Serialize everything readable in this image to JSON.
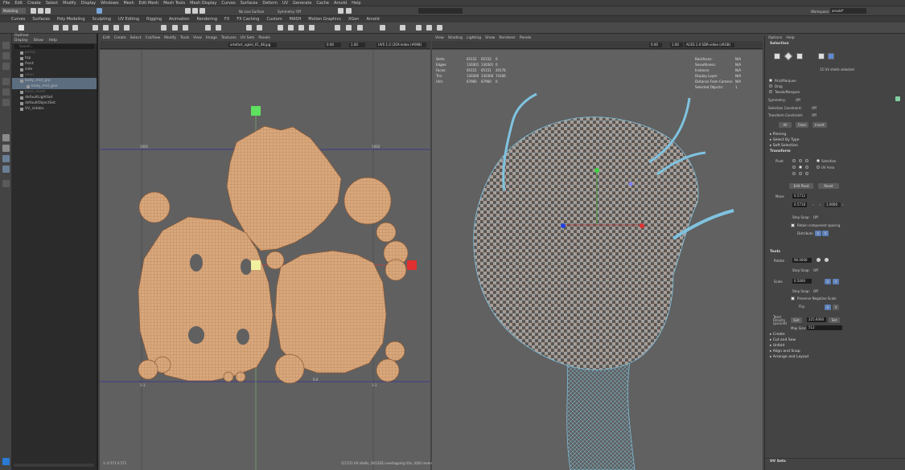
{
  "menubar": {
    "items": [
      "File",
      "Edit",
      "Create",
      "Select",
      "Modify",
      "Display",
      "Windows",
      "Mesh",
      "Edit Mesh",
      "Mesh Tools",
      "Mesh Display",
      "Curves",
      "Surfaces",
      "Deform",
      "UV",
      "Generate",
      "Cache",
      "Arnold",
      "Help"
    ],
    "workspace_label": "Workspace:",
    "workspace_value": "arnold*"
  },
  "status": {
    "mode": "Modeling",
    "live_surface": "No Live Surface",
    "symmetry": "Symmetry: Off"
  },
  "shelf_tabs": [
    "Curves",
    "Surfaces",
    "Poly Modeling",
    "Sculpting",
    "UV Editing",
    "Rigging",
    "Animation",
    "Rendering",
    "FX",
    "FX Caching",
    "Custom",
    "MASH",
    "Motion Graphics",
    "XGen",
    "Arnold"
  ],
  "outliner": {
    "title": "Outliner",
    "menu": [
      "Display",
      "Show",
      "Help"
    ],
    "search_placeholder": "Search...",
    "items": [
      {
        "label": "persp",
        "dim": true,
        "sel": false,
        "indent": 10
      },
      {
        "label": "top",
        "dim": false,
        "sel": false,
        "indent": 10
      },
      {
        "label": "front",
        "dim": false,
        "sel": false,
        "indent": 10
      },
      {
        "label": "side",
        "dim": false,
        "sel": false,
        "indent": 10
      },
      {
        "label": "alien",
        "dim": true,
        "sel": false,
        "indent": 10
      },
      {
        "label": "body_mid_grp",
        "dim": false,
        "sel": true,
        "indent": 10
      },
      {
        "label": "body_mid_geo",
        "dim": false,
        "sel": true,
        "indent": 18
      },
      {
        "label": "base_mesh",
        "dim": true,
        "sel": false,
        "indent": 10
      },
      {
        "label": "defaultLightSet",
        "dim": false,
        "sel": false,
        "indent": 10
      },
      {
        "label": "defaultObjectSet",
        "dim": false,
        "sel": false,
        "indent": 10
      },
      {
        "label": "UV_sidebn",
        "dim": false,
        "sel": false,
        "indent": 10
      }
    ]
  },
  "uv_editor": {
    "menu": [
      "Edit",
      "Create",
      "Select",
      "Cut/Sew",
      "Modify",
      "Tools",
      "View",
      "Image",
      "Textures",
      "UV Sets",
      "Panels"
    ],
    "texture_field": "artefact_ogkid_01_48.jpg",
    "exposure": "0.00",
    "gamma": "1.00",
    "uvset": "UVS 1:2 (20X-index (#008)",
    "tile_labels": [
      "1001",
      "1002",
      "1-1",
      "1-1",
      "0,0"
    ],
    "footer_left": "1: 0.571 0.571",
    "footer_right": "(157/2) UV shells, (6/1262) overlapping UVs, (0/0) reversed UVs"
  },
  "viewport": {
    "menu": [
      "View",
      "Shading",
      "Lighting",
      "Show",
      "Renderer",
      "Panels"
    ],
    "exposure": "0.00",
    "gamma": "1.00",
    "colorspace": "ACES 1.0 SDR-video (sRGB)",
    "hud_left": [
      [
        "Verts:",
        "65152",
        "65152",
        "0"
      ],
      [
        "Edges:",
        "130301",
        "130301",
        "0"
      ],
      [
        "Faces:",
        "65151",
        "65151",
        "20178"
      ],
      [
        "Tris:",
        "130300",
        "130300",
        "74106"
      ],
      [
        "UVs:",
        "67960",
        "67960",
        "0"
      ]
    ],
    "hud_right": [
      [
        "Backfaces:",
        "N/A"
      ],
      [
        "Smoothness:",
        "N/A"
      ],
      [
        "Instance:",
        "N/A"
      ],
      [
        "Display Layer:",
        "N/A"
      ],
      [
        "Distance From Camera:",
        "N/A"
      ],
      [
        "Selected Objects:",
        "1"
      ]
    ]
  },
  "toolkit": {
    "menu": [
      "Options",
      "Help"
    ],
    "selection_header": "Selection",
    "shells_selected": "15 UV shells selected",
    "sel_modes": [
      "Pick/Marquee",
      "Drag",
      "Tweak/Marquee"
    ],
    "symmetry_label": "Symmetry:",
    "symmetry_value": "Off",
    "sel_constraint_label": "Selection Constraint:",
    "sel_constraint_value": "Off",
    "transform_constraint_label": "Transform Constraint:",
    "transform_constraint_value": "Off",
    "select_buttons": [
      "All",
      "Clear",
      "Invert"
    ],
    "collapsed": [
      "Pinning",
      "Select By Type",
      "Soft Selection"
    ],
    "transform_header": "Transform",
    "pivot_label": "Pivot",
    "pivot_opts": [
      "Selection",
      "UV Area"
    ],
    "edit_pivot": "Edit Pivot",
    "reset": "Reset",
    "move_label": "Move",
    "move_u": "0.5712",
    "move_v": "0.5718",
    "move_step": "1.0000",
    "step_snap_label": "Step Snap:",
    "step_snap_value": "Off",
    "retain_spacing": "Retain component spacing",
    "distribute_label": "Distribute",
    "tools_header": "Tools",
    "rotate_label": "Rotate",
    "rotate_value": "90.0000",
    "scale_label": "Scale",
    "scale_value": "0.5000",
    "preserve_neg": "Preserve Negative Scale",
    "flip_label": "Flip",
    "u": "U",
    "v": "V",
    "texel_label": "Texel Density (px/unit)",
    "get": "Get",
    "set": "Set",
    "texel_value": "225.6000",
    "map_size_label": "Map Size:",
    "map_size_value": "512",
    "bottom_sections": [
      "Create",
      "Cut and Sew",
      "Unfold",
      "Align and Snap",
      "Arrange and Layout"
    ],
    "uvsets": "UV Sets"
  },
  "colors": {
    "uv_fill": "#d9a77c",
    "uv_line": "#b07a50",
    "wire": "#7fc3e0",
    "checker_a": "#a89c94",
    "checker_b": "#5b5552",
    "sel_blue": "#5c6d80"
  }
}
